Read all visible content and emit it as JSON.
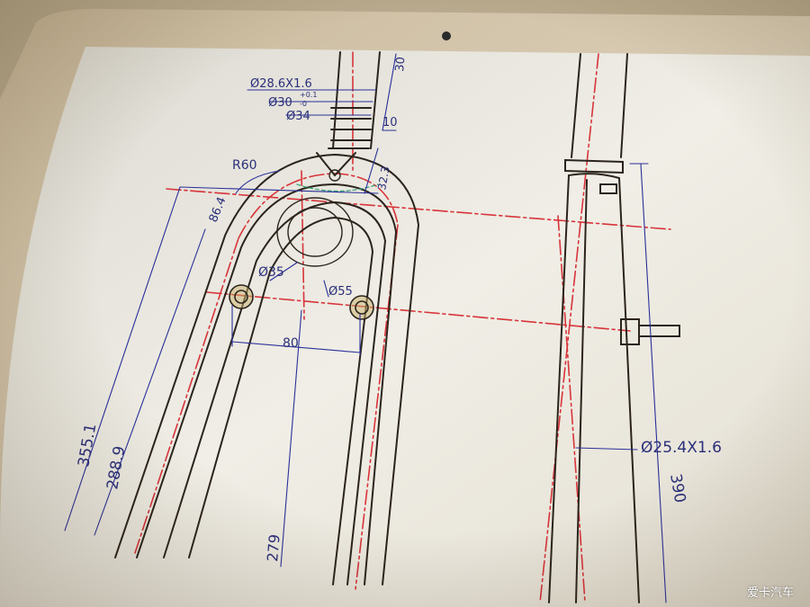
{
  "drawing": {
    "dims": {
      "top_tube_od": "Ø28.6X1.6",
      "tol": "+0.1",
      "tol_low": "-0",
      "d30": "Ø30",
      "d34": "Ø34",
      "len30": "30",
      "len10": "10",
      "len32_3": "32.3",
      "r60": "R60",
      "d86_4": "86.4",
      "d35": "Ø35",
      "d55": "Ø55",
      "w80": "80",
      "h355_1": "355.1",
      "h288_9": "288.9",
      "h279": "279",
      "side_od": "Ø25.4X1.6",
      "h390": "390"
    }
  },
  "watermark": "爱卡汽车",
  "colors": {
    "paper": "#efece4",
    "line": "#2b241c",
    "center": "#d8343a",
    "dim": "#2a2f9a",
    "green": "#3aa57a"
  }
}
